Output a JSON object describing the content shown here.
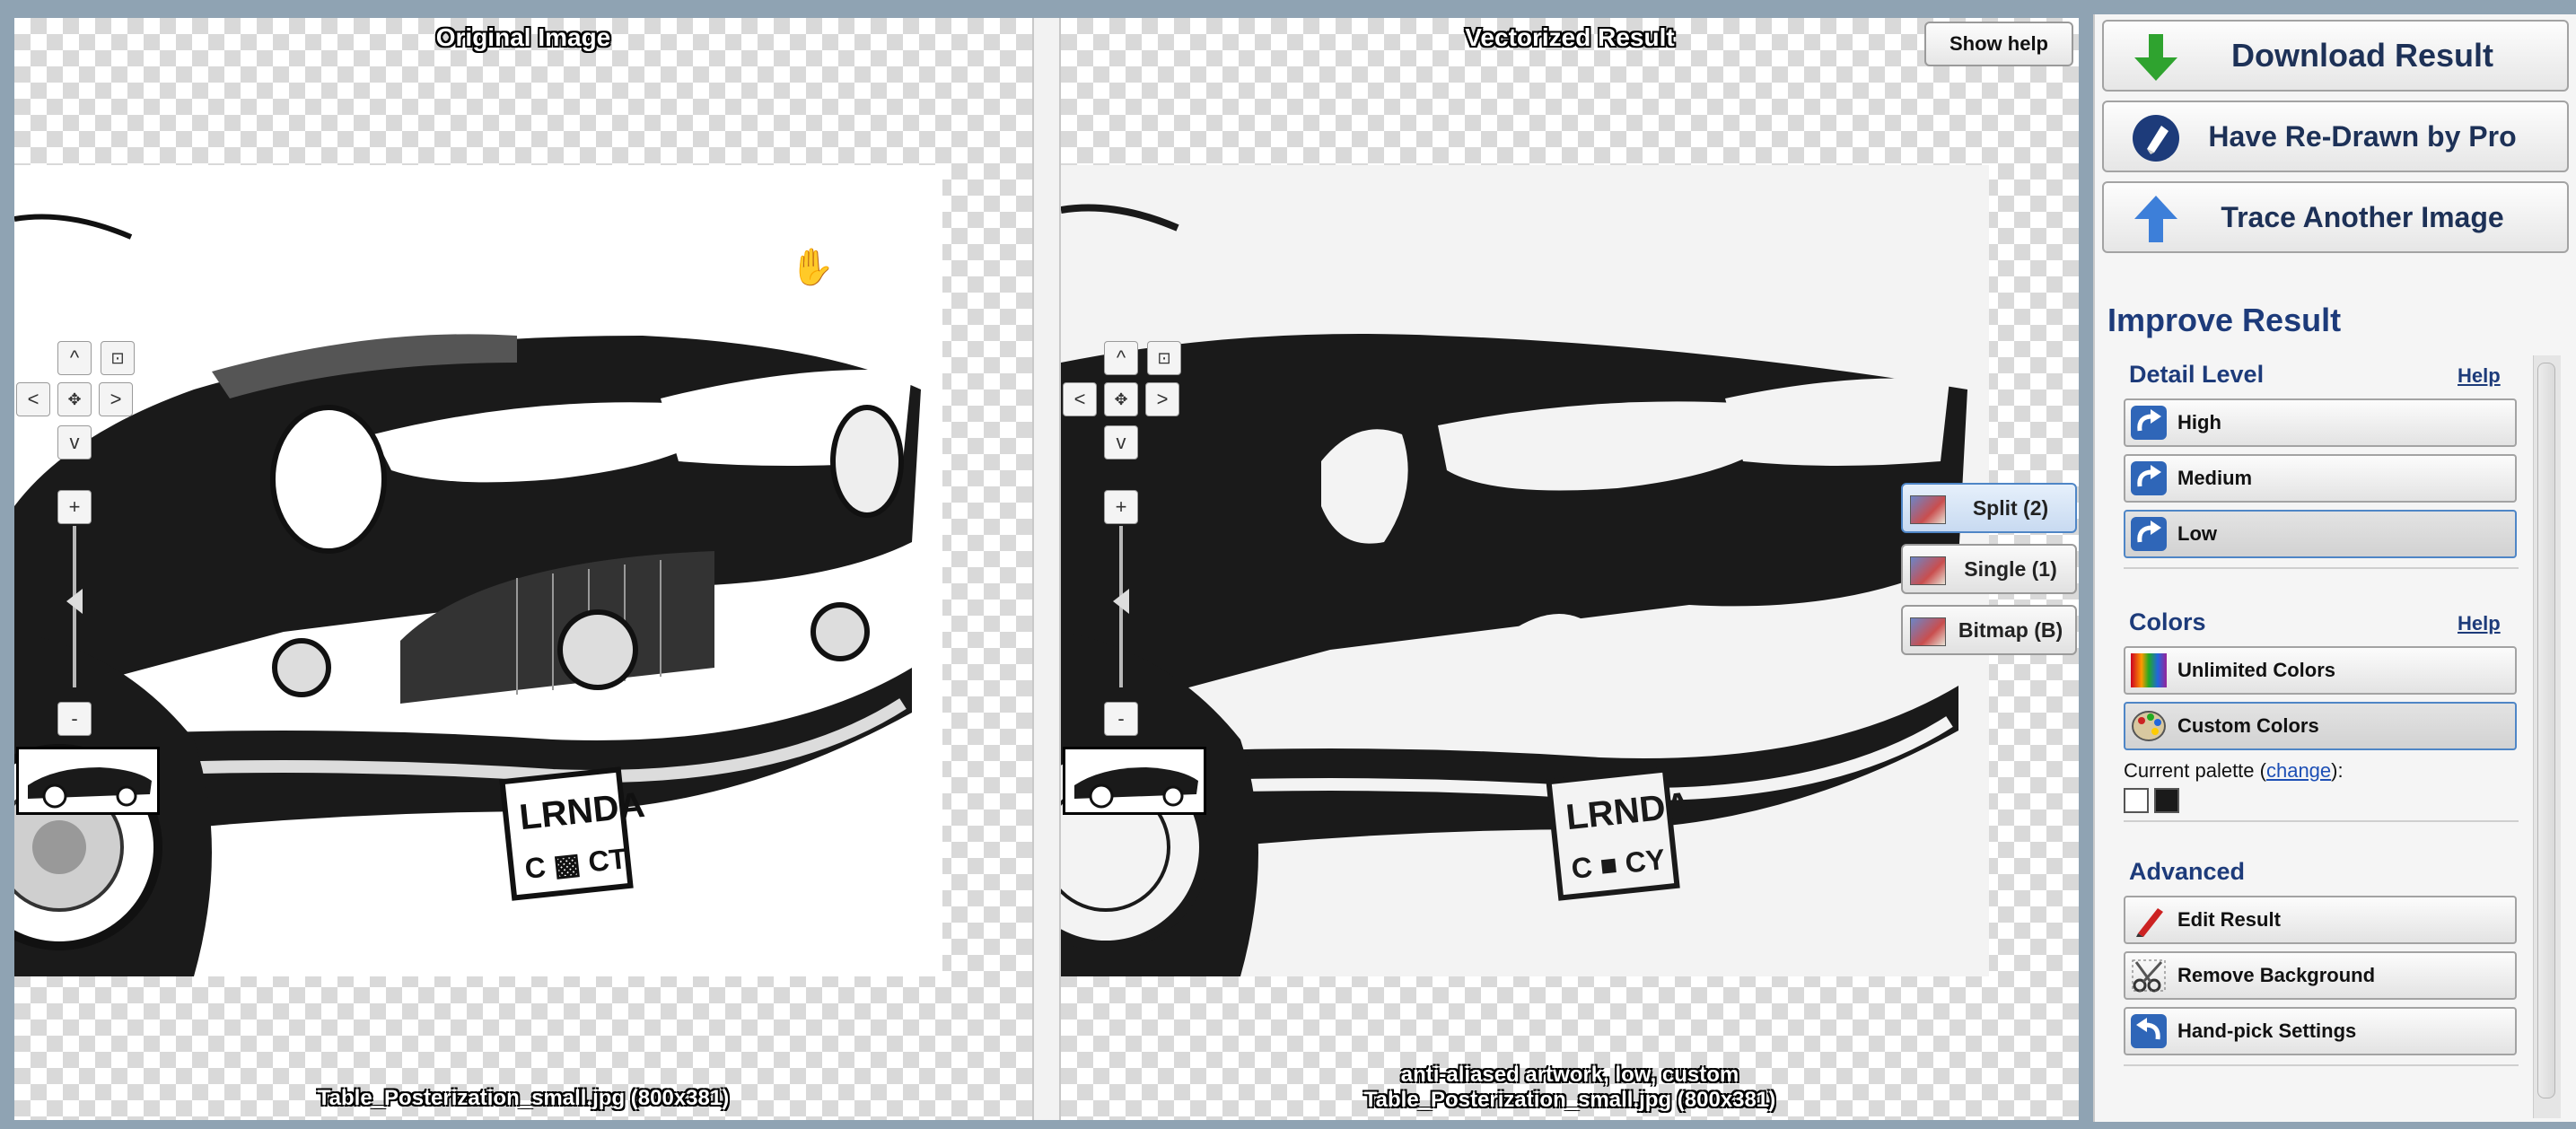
{
  "left_pane": {
    "title": "Original Image",
    "caption": "Table_Posterization_small.jpg  (800x381)"
  },
  "right_pane": {
    "title": "Vectorized Result",
    "caption_line1": "anti-aliased artwork, low, custom",
    "caption_line2": "Table_Posterization_small.jpg  (800x381)",
    "show_help_label": "Show help"
  },
  "nav_controls": {
    "up": "^",
    "left": "<",
    "right": ">",
    "down": "v",
    "zoom_in": "+",
    "zoom_out": "-"
  },
  "view_modes": [
    {
      "label": "Split (2)",
      "active": true
    },
    {
      "label": "Single (1)",
      "active": false
    },
    {
      "label": "Bitmap (B)",
      "active": false
    }
  ],
  "sidebar": {
    "download_label": "Download Result",
    "redrawn_label": "Have Re-Drawn by Pro",
    "trace_label": "Trace Another Image",
    "improve_title": "Improve Result",
    "detail_level": {
      "title": "Detail Level",
      "help": "Help",
      "options": [
        {
          "label": "High",
          "selected": false
        },
        {
          "label": "Medium",
          "selected": false
        },
        {
          "label": "Low",
          "selected": true
        }
      ]
    },
    "colors": {
      "title": "Colors",
      "help": "Help",
      "options": [
        {
          "label": "Unlimited Colors",
          "selected": false
        },
        {
          "label": "Custom Colors",
          "selected": true
        }
      ],
      "palette_prefix": "Current palette (",
      "palette_link": "change",
      "palette_suffix": "):",
      "palette": [
        "#ffffff",
        "#1a1a1a"
      ]
    },
    "advanced": {
      "title": "Advanced",
      "options": [
        {
          "label": "Edit Result"
        },
        {
          "label": "Remove Background"
        },
        {
          "label": "Hand-pick Settings"
        }
      ]
    }
  },
  "colors": {
    "accent_blue": "#4f86c6",
    "heading_navy": "#1d3b7a",
    "download_arrow": "#2fa32f"
  }
}
